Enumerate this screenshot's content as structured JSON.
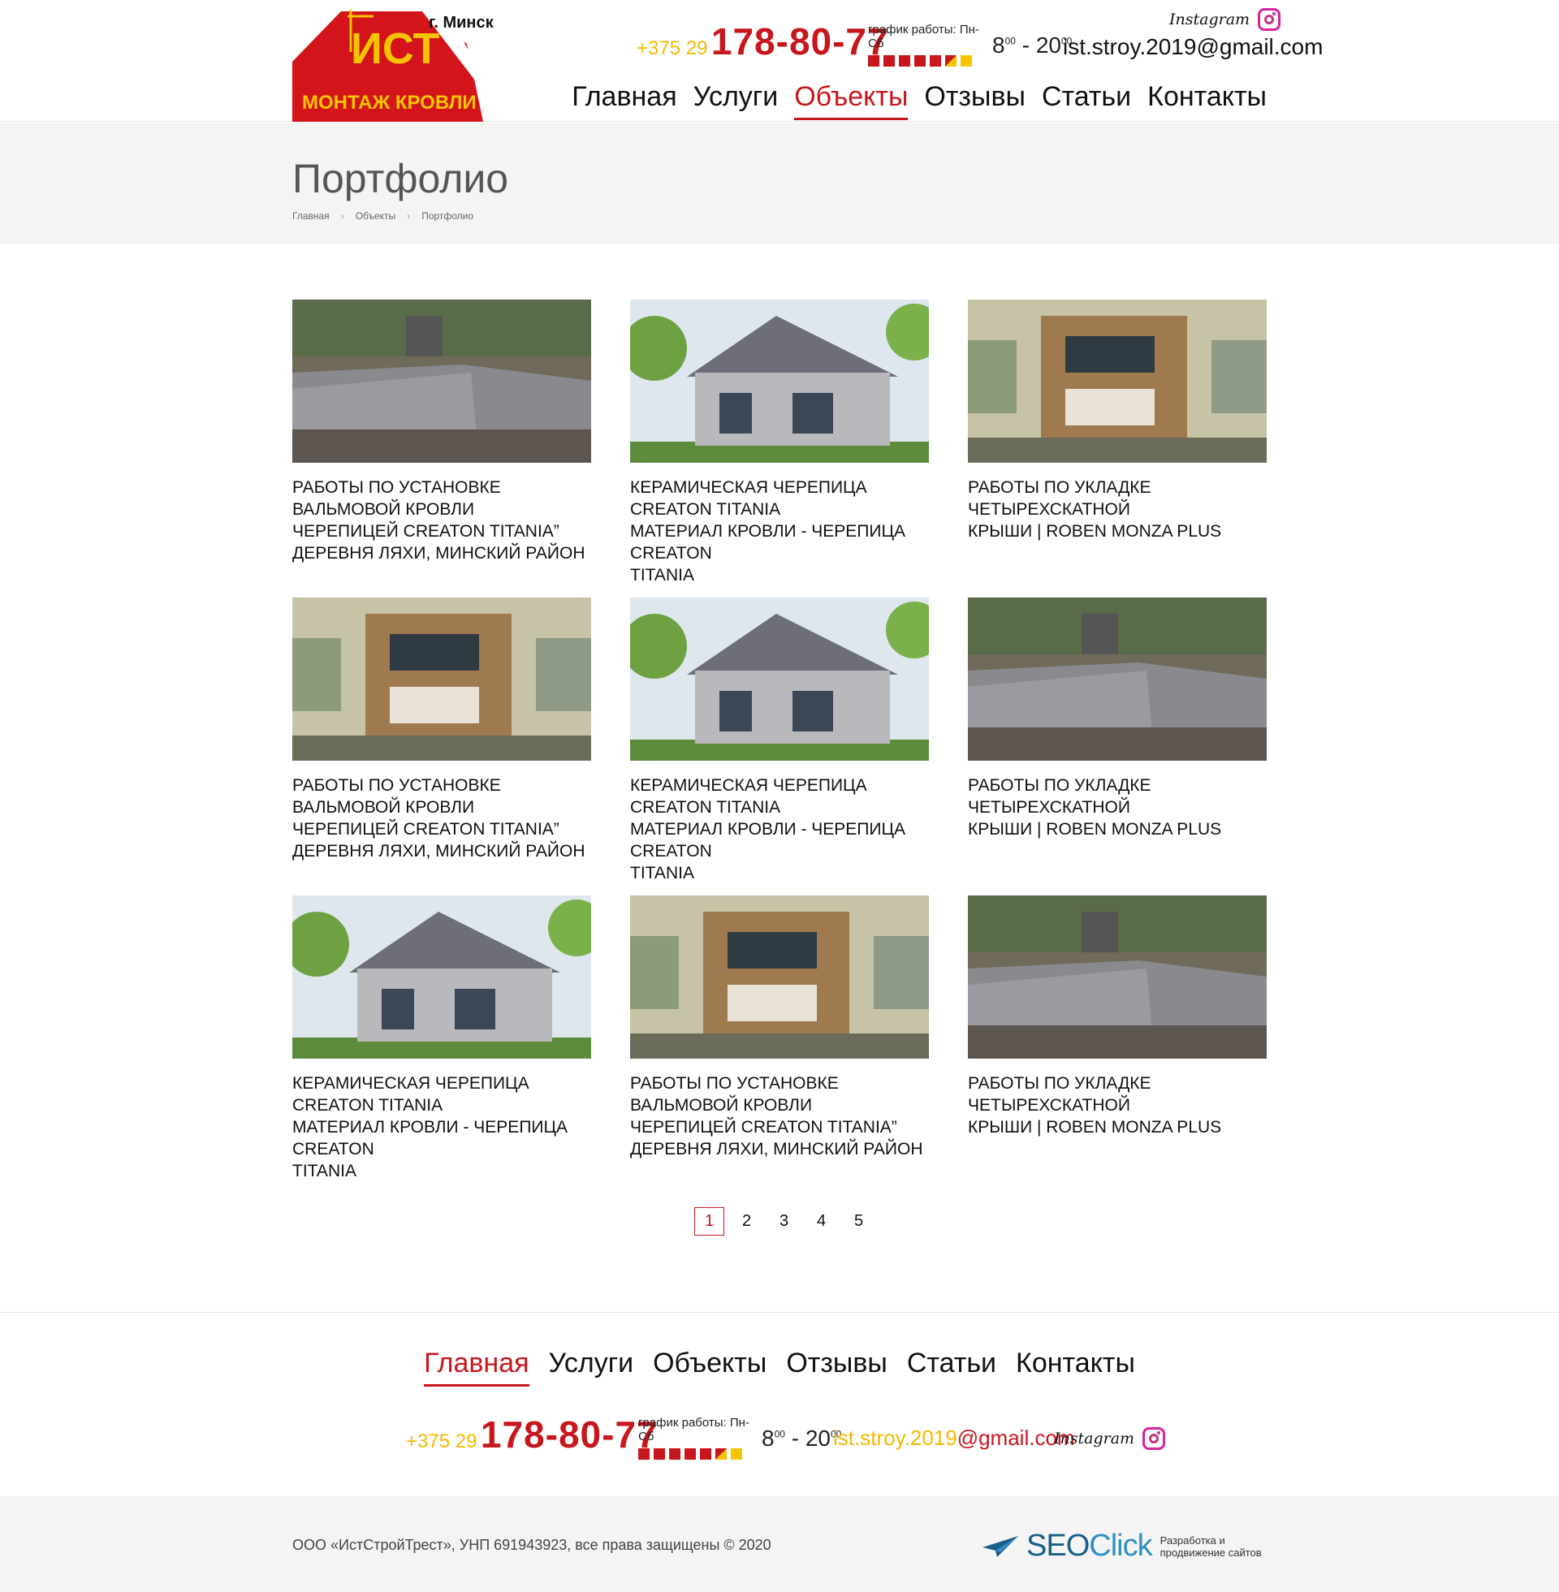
{
  "brand": {
    "logo_main": "ИСТ",
    "logo_sub": "МОНТАЖ КРОВЛИ",
    "city": "г. Минск"
  },
  "contact": {
    "phone_prefix": "+375 29",
    "phone_main": "178-80-77",
    "schedule_label": "график работы: Пн-Сб",
    "hours_from": "8",
    "hours_from_sup": "00",
    "hours_to": "- 20",
    "hours_to_sup": "00",
    "instagram": "Instagram",
    "email": "ist.stroy.2019@gmail.com",
    "email_user": "ist.stroy.2019",
    "email_domain": "@gmail.com"
  },
  "nav": [
    "Главная",
    "Услуги",
    "Объекты",
    "Отзывы",
    "Статьи",
    "Контакты"
  ],
  "page": {
    "title": "Портфолио",
    "breadcrumb": [
      "Главная",
      "Объекты",
      "Портфолио"
    ]
  },
  "projects": [
    {
      "image": "roof-aerial",
      "lines": [
        "РАБОТЫ ПО УСТАНОВКЕ ВАЛЬМОВОЙ КРОВЛИ",
        "ЧЕРЕПИЦЕЙ CREATON TITANIA”",
        "ДЕРЕВНЯ ЛЯХИ, МИНСКИЙ РАЙОН"
      ]
    },
    {
      "image": "chalet-house",
      "lines": [
        "КЕРАМИЧЕСКАЯ ЧЕРЕПИЦА CREATON TITANIA",
        "МАТЕРИАЛ КРОВЛИ - ЧЕРЕПИЦА CREATON",
        "TITANIA"
      ]
    },
    {
      "image": "modern-house",
      "lines": [
        "РАБОТЫ ПО УКЛАДКЕ ЧЕТЫРЕХСКАТНОЙ",
        "КРЫШИ | ROBEN MONZA PLUS"
      ]
    },
    {
      "image": "modern-house",
      "lines": [
        "РАБОТЫ ПО УСТАНОВКЕ ВАЛЬМОВОЙ КРОВЛИ",
        "ЧЕРЕПИЦЕЙ CREATON TITANIA”",
        "ДЕРЕВНЯ ЛЯХИ, МИНСКИЙ РАЙОН"
      ]
    },
    {
      "image": "chalet-house",
      "lines": [
        "КЕРАМИЧЕСКАЯ ЧЕРЕПИЦА CREATON TITANIA",
        "МАТЕРИАЛ КРОВЛИ - ЧЕРЕПИЦА CREATON",
        "TITANIA"
      ]
    },
    {
      "image": "roof-aerial",
      "lines": [
        "РАБОТЫ ПО УКЛАДКЕ ЧЕТЫРЕХСКАТНОЙ",
        "КРЫШИ | ROBEN MONZA PLUS"
      ]
    },
    {
      "image": "chalet-house",
      "lines": [
        "КЕРАМИЧЕСКАЯ ЧЕРЕПИЦА CREATON TITANIA",
        "МАТЕРИАЛ КРОВЛИ - ЧЕРЕПИЦА CREATON",
        "TITANIA"
      ]
    },
    {
      "image": "modern-house",
      "lines": [
        "РАБОТЫ ПО УСТАНОВКЕ ВАЛЬМОВОЙ КРОВЛИ",
        "ЧЕРЕПИЦЕЙ CREATON TITANIA”",
        "ДЕРЕВНЯ ЛЯХИ, МИНСКИЙ РАЙОН"
      ]
    },
    {
      "image": "roof-aerial",
      "lines": [
        "РАБОТЫ ПО УКЛАДКЕ ЧЕТЫРЕХСКАТНОЙ",
        "КРЫШИ | ROBEN MONZA PLUS"
      ]
    }
  ],
  "pagination": {
    "pages": [
      "1",
      "2",
      "3",
      "4",
      "5"
    ],
    "current": "1"
  },
  "footer": {
    "copyright": "ООО «ИстСтройТрест», УНП 691943923, все права защищены © 2020",
    "dev_brand_a": "SEO",
    "dev_brand_b": "Click",
    "dev_desc": "Разработка и продвижение сайтов"
  },
  "colors": {
    "accent": "#c8161d",
    "yellow": "#f5c400",
    "band": "#f4f4f4"
  }
}
